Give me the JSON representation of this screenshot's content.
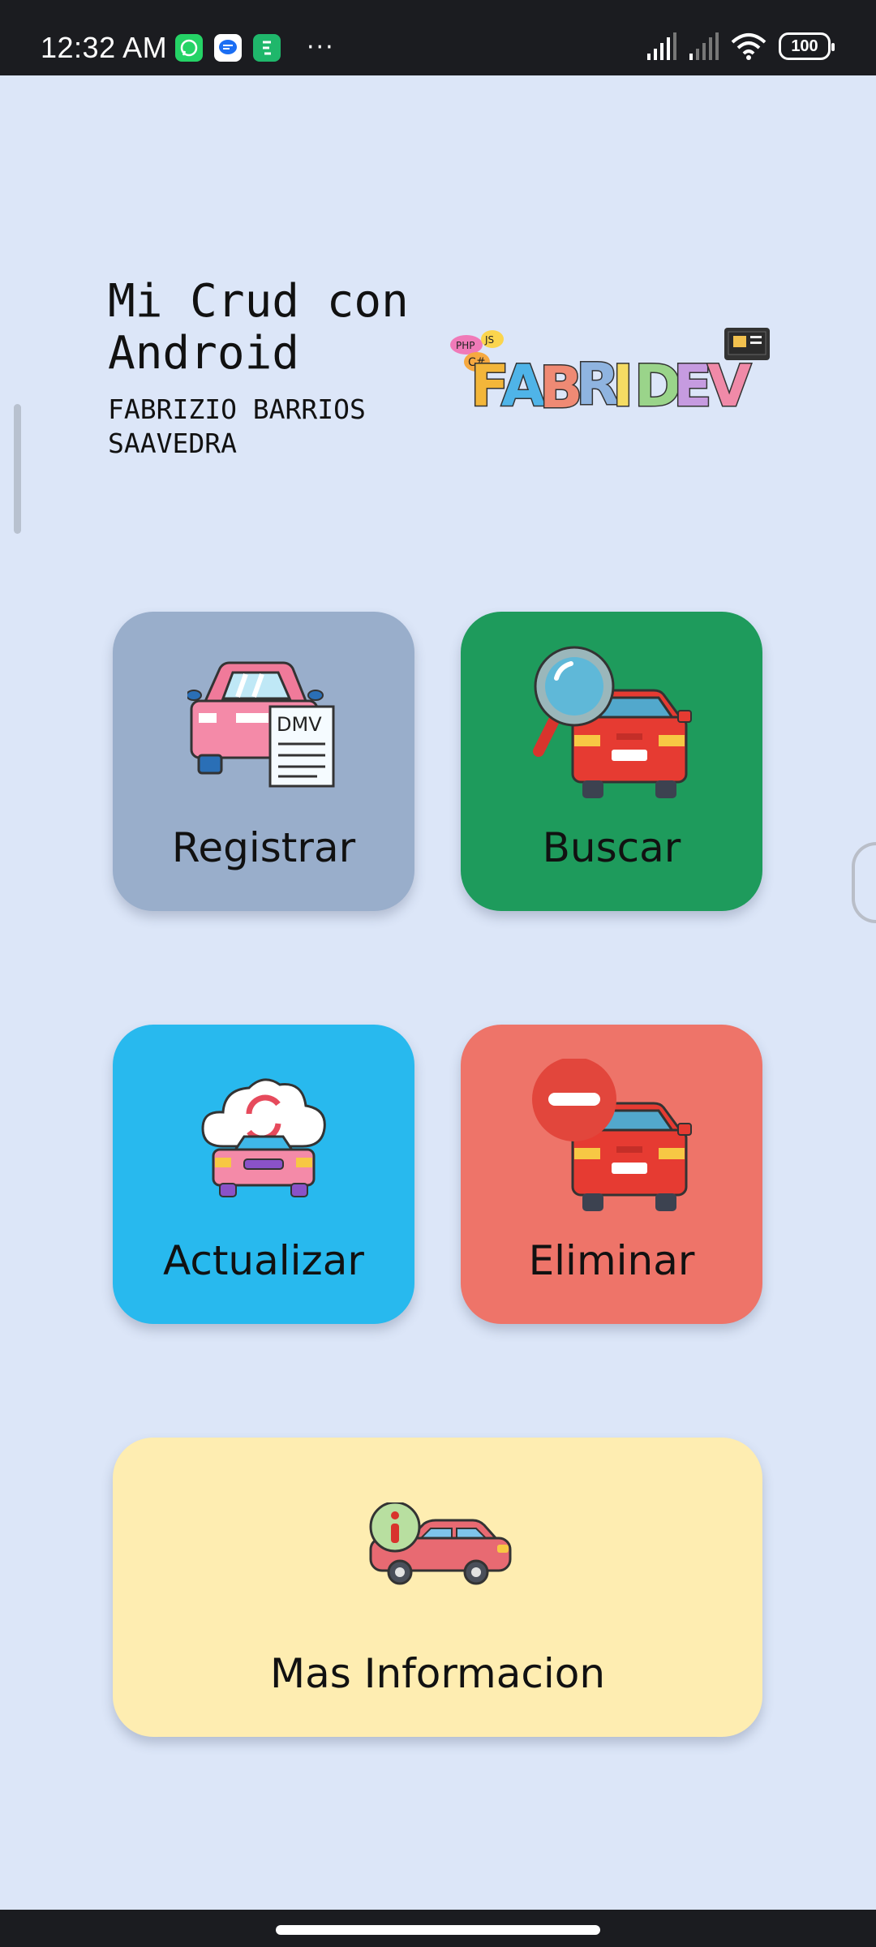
{
  "status_bar": {
    "time": "12:32 AM",
    "notification_icons": [
      "whatsapp-icon",
      "messages-icon",
      "green-app-icon"
    ],
    "more": "···",
    "battery": "100"
  },
  "header": {
    "title": "Mi Crud con\nAndroid",
    "author": "FABRIZIO BARRIOS\nSAAVEDRA",
    "logo_text": "FABRIDEV",
    "logo_tags": [
      "PHP",
      "JS",
      "C#"
    ]
  },
  "tiles": {
    "registrar": {
      "label": "Registrar",
      "icon": "car-dmv-document-icon",
      "color": "#99aecb"
    },
    "buscar": {
      "label": "Buscar",
      "icon": "car-search-icon",
      "color": "#1e9b5c"
    },
    "actualizar": {
      "label": "Actualizar",
      "icon": "car-cloud-refresh-icon",
      "color": "#28b9ee"
    },
    "eliminar": {
      "label": "Eliminar",
      "icon": "car-remove-icon",
      "color": "#ee7469"
    },
    "mas_info": {
      "label": "Mas Informacion",
      "icon": "car-info-icon",
      "color": "#feedb1"
    }
  },
  "dmv_text": "DMV"
}
